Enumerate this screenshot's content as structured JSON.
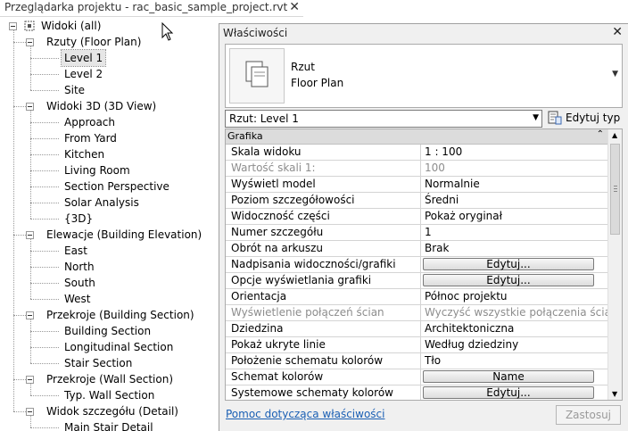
{
  "browser": {
    "title": "Przeglądarka projektu - rac_basic_sample_project.rvt",
    "close": "✕",
    "root": "Widoki (all)",
    "groups": [
      {
        "label": "Rzuty (Floor Plan)",
        "items": [
          "Level 1",
          "Level 2",
          "Site"
        ]
      },
      {
        "label": "Widoki 3D (3D View)",
        "items": [
          "Approach",
          "From Yard",
          "Kitchen",
          "Living Room",
          "Section Perspective",
          "Solar Analysis",
          "{3D}"
        ]
      },
      {
        "label": "Elewacje (Building Elevation)",
        "items": [
          "East",
          "North",
          "South",
          "West"
        ]
      },
      {
        "label": "Przekroje (Building Section)",
        "items": [
          "Building Section",
          "Longitudinal Section",
          "Stair Section"
        ]
      },
      {
        "label": "Przekroje (Wall Section)",
        "items": [
          "Typ. Wall Section"
        ]
      },
      {
        "label": "Widok szczegółu (Detail)",
        "items": [
          "Main Stair Detail"
        ]
      }
    ],
    "selected": "Level 1"
  },
  "properties": {
    "title": "Właściwości",
    "close": "✕",
    "type": {
      "line1": "Rzut",
      "line2": "Floor Plan"
    },
    "instance_select": "Rzut: Level 1",
    "edit_type_label": "Edytuj typ",
    "section_label": "Grafika",
    "rows": [
      {
        "name": "Skala widoku",
        "value": "1 : 100",
        "kind": "text"
      },
      {
        "name": "Wartość skali   1:",
        "value": "100",
        "kind": "disabled"
      },
      {
        "name": "Wyświetl model",
        "value": "Normalnie",
        "kind": "text"
      },
      {
        "name": "Poziom szczegółowości",
        "value": "Średni",
        "kind": "text"
      },
      {
        "name": "Widoczność części",
        "value": "Pokaż oryginał",
        "kind": "text"
      },
      {
        "name": "Numer szczegółu",
        "value": "1",
        "kind": "text"
      },
      {
        "name": "Obrót na arkuszu",
        "value": "Brak",
        "kind": "text"
      },
      {
        "name": "Nadpisania widoczności/grafiki",
        "value": "Edytuj...",
        "kind": "button"
      },
      {
        "name": "Opcje wyświetlania grafiki",
        "value": "Edytuj...",
        "kind": "button"
      },
      {
        "name": "Orientacja",
        "value": "Północ projektu",
        "kind": "text"
      },
      {
        "name": "Wyświetlenie połączeń ścian",
        "value": "Wyczyść wszystkie połączenia ścian",
        "kind": "disabled"
      },
      {
        "name": "Dziedzina",
        "value": "Architektoniczna",
        "kind": "text"
      },
      {
        "name": "Pokaż ukryte linie",
        "value": "Według dziedziny",
        "kind": "text"
      },
      {
        "name": "Położenie schematu kolorów",
        "value": "Tło",
        "kind": "text"
      },
      {
        "name": "Schemat kolorów",
        "value": "Name",
        "kind": "button"
      },
      {
        "name": "Systemowe schematy kolorów",
        "value": "Edytuj...",
        "kind": "button"
      }
    ],
    "help_link": "Pomoc dotycząca właściwości",
    "apply_label": "Zastosuj"
  }
}
